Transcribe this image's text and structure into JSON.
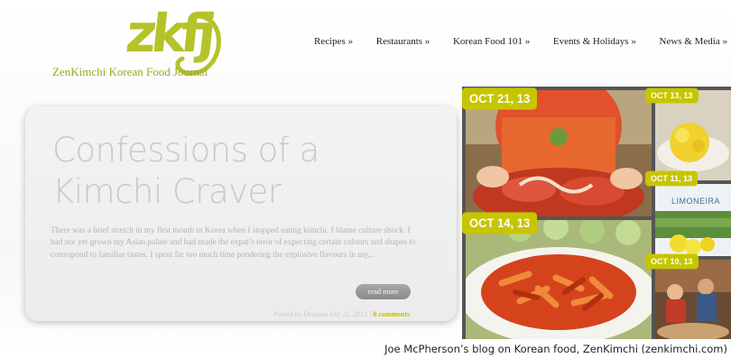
{
  "site": {
    "logo_mark": "zkfj",
    "logo_text": "ZenKimchi Korean Food Journal",
    "brand_color": "#b6c22a"
  },
  "nav": {
    "items": [
      "Recipes »",
      "Restaurants »",
      "Korean Food 101 »",
      "Events & Holidays »",
      "News & Media »"
    ]
  },
  "post": {
    "title_line1": "Confessions of a",
    "title_line2": "Kimchi Craver",
    "excerpt": "There was a brief stretch in my first month in Korea when I stopped eating kimchi. I blame culture shock. I had not yet grown my Asian palate and had made the expat’s error of expecting certain colours and shapes to correspond to familiar tastes. I spent far too much time pondering the explosive flavours in my...",
    "read_more": "read more",
    "meta_prefix": "Posted by Dessaan Oct 21, 2013 |",
    "comments": "0 comments"
  },
  "gallery": {
    "badges": [
      "OCT 21, 13",
      "OCT 13, 13",
      "OCT 11, 13",
      "OCT 14, 13",
      "OCT 10, 13"
    ],
    "brand_label": "LIMONEIRA",
    "badge_color": "#c6c500"
  },
  "caption": "Joe McPherson’s blog on Korean food, ZenKimchi (zenkimchi.com)"
}
